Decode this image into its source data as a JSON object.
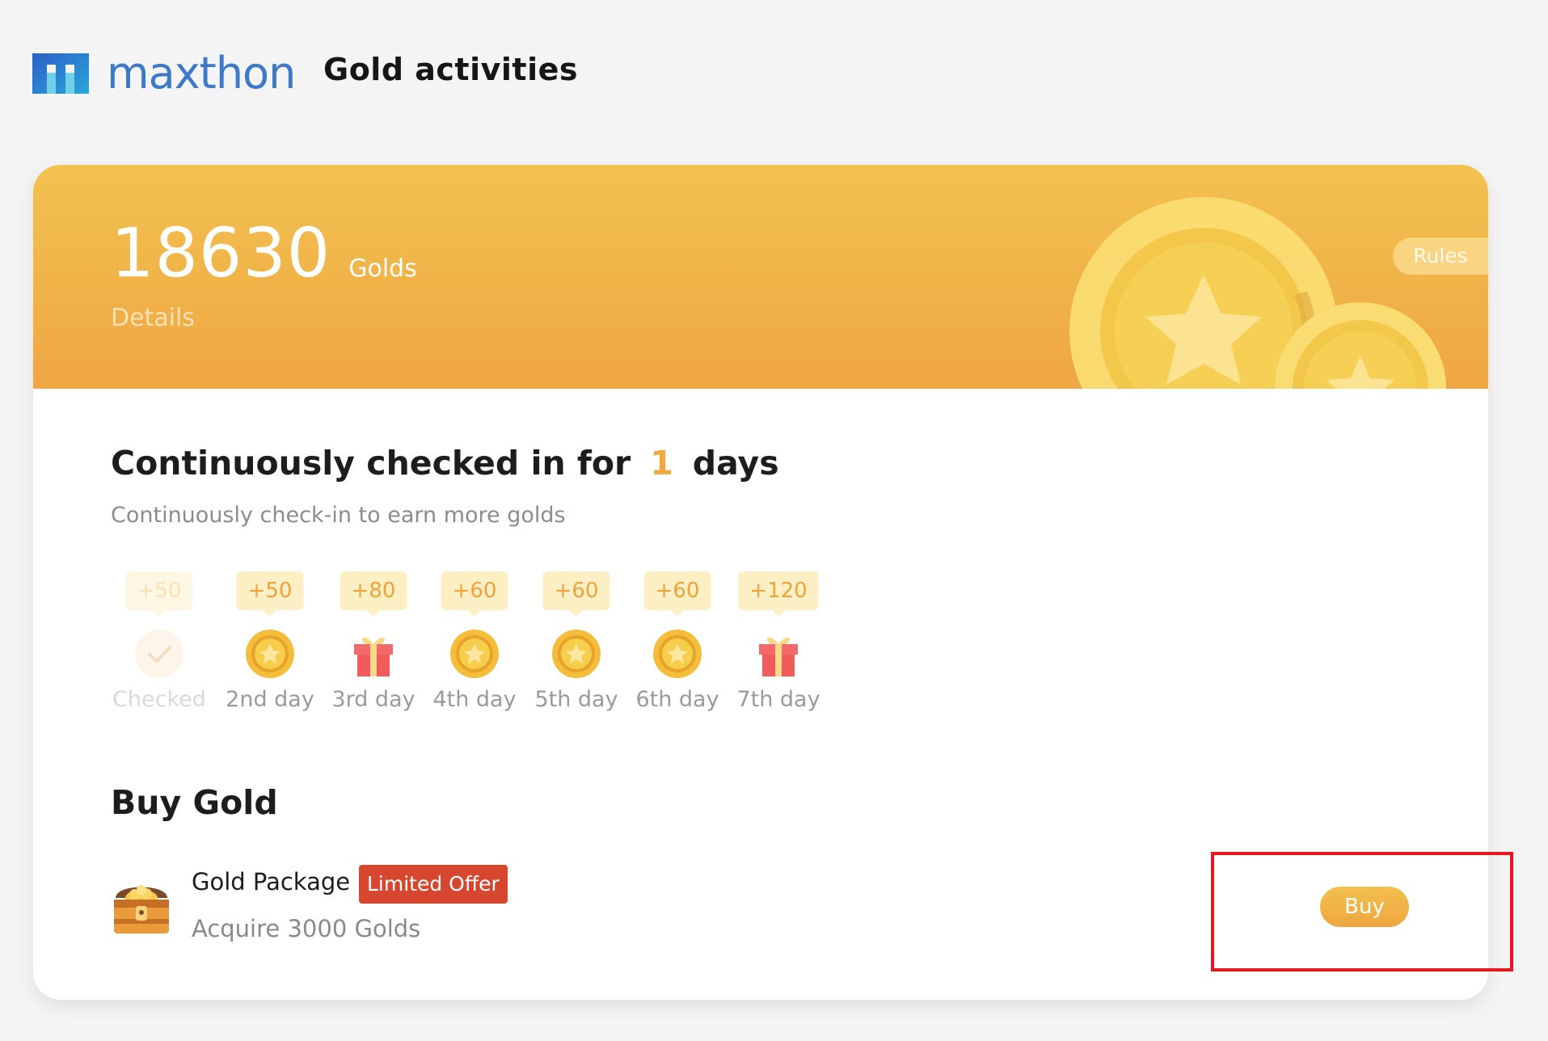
{
  "header": {
    "logo_text": "maxthon",
    "page_title": "Gold activities"
  },
  "balance": {
    "amount": "18630",
    "unit": "Golds",
    "details_label": "Details",
    "rules_label": "Rules"
  },
  "checkin": {
    "title_prefix": "Continuously checked in for",
    "days_count": "1",
    "title_suffix": "days",
    "subtitle": "Continuously check-in to earn more golds",
    "days": [
      {
        "reward": "+50",
        "label": "Checked",
        "icon": "check-icon",
        "checked": true
      },
      {
        "reward": "+50",
        "label": "2nd day",
        "icon": "coin-icon",
        "checked": false
      },
      {
        "reward": "+80",
        "label": "3rd day",
        "icon": "gift-icon",
        "checked": false
      },
      {
        "reward": "+60",
        "label": "4th day",
        "icon": "coin-icon",
        "checked": false
      },
      {
        "reward": "+60",
        "label": "5th day",
        "icon": "coin-icon",
        "checked": false
      },
      {
        "reward": "+60",
        "label": "6th day",
        "icon": "coin-icon",
        "checked": false
      },
      {
        "reward": "+120",
        "label": "7th day",
        "icon": "gift-icon",
        "checked": false
      }
    ]
  },
  "buy": {
    "title": "Buy Gold",
    "package": {
      "name": "Gold Package",
      "badge": "Limited Offer",
      "description": "Acquire 3000 Golds",
      "icon": "treasure-chest-icon",
      "button_label": "Buy"
    }
  },
  "colors": {
    "background": "#f4f4f4",
    "banner_top": "#f2c24f",
    "banner_bottom": "#efa643",
    "accent": "#f1a93f",
    "badge": "#d7472f",
    "highlight": "#e8161e",
    "logo": "#3c79c9"
  }
}
